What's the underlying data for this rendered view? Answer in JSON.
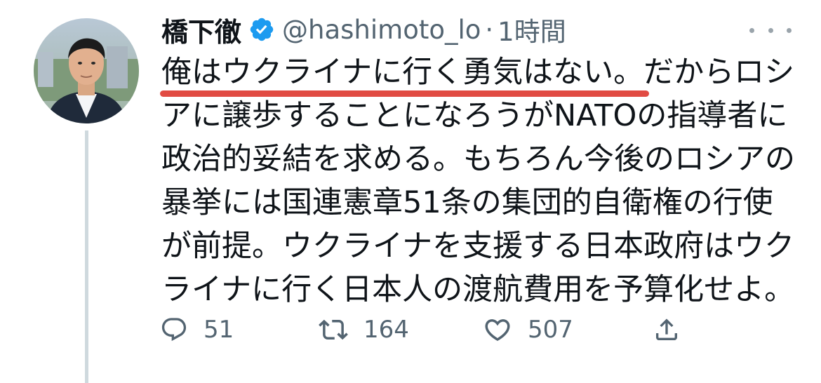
{
  "tweet": {
    "author": {
      "display_name": "橋下徹",
      "handle": "@hashimoto_lo",
      "verified": true
    },
    "separator": "·",
    "time": "1時間",
    "text_lines": [
      {
        "highlighted": "俺はウクライナに行く勇気はない。",
        "rest": "だからロシ"
      },
      {
        "text": "アに譲歩することになろうがNATOの指導者に"
      },
      {
        "text": "政治的妥結を求める。もちろん今後のロシアの"
      },
      {
        "text": "暴挙には国連憲章51条の集団的自衛権の行使"
      },
      {
        "text": "が前提。ウクライナを支援する日本政府はウク"
      },
      {
        "text": "ライナに行く日本人の渡航費用を予算化せよ。"
      }
    ],
    "stats": {
      "replies": "51",
      "retweets": "164",
      "likes": "507"
    }
  },
  "icons": {
    "verified": "verified-badge-icon",
    "more": "more-horizontal-icon",
    "reply": "reply-icon",
    "retweet": "retweet-icon",
    "like": "heart-icon",
    "share": "share-icon"
  },
  "colors": {
    "verified_blue": "#1d9bf0",
    "secondary_text": "#536471",
    "highlight_underline": "#e14b43",
    "thread_line": "#cfd9de"
  }
}
